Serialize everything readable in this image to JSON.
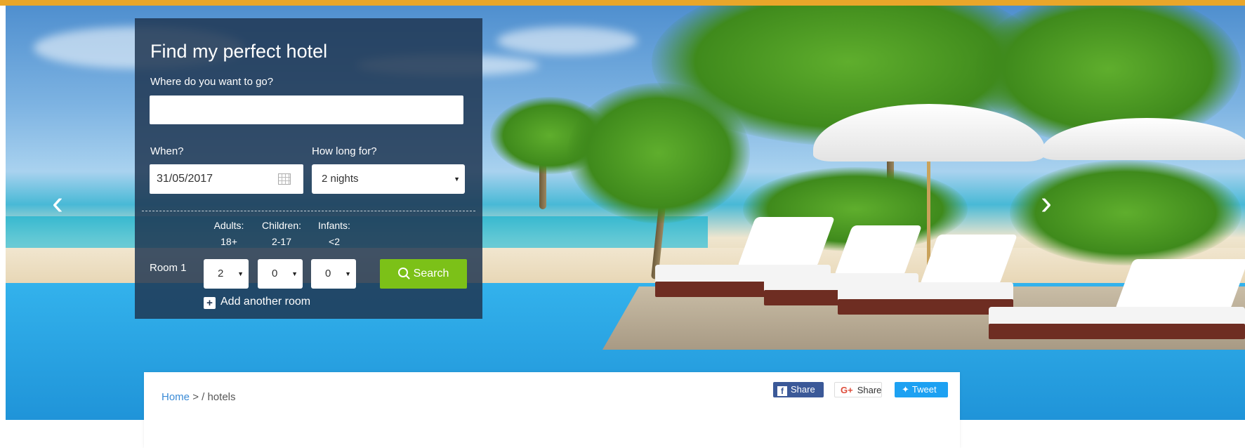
{
  "panel": {
    "title": "Find my perfect hotel",
    "destination_label": "Where do you want to go?",
    "destination_value": "",
    "when_label": "When?",
    "date_value": "31/05/2017",
    "duration_label": "How long for?",
    "duration_value": "2 nights",
    "adults_label": "Adults:",
    "adults_range": "18+",
    "children_label": "Children:",
    "children_range": "2-17",
    "infants_label": "Infants:",
    "infants_range": "<2",
    "room_label": "Room 1",
    "adults_value": "2",
    "children_value": "0",
    "infants_value": "0",
    "search_label": "Search",
    "add_room_label": "Add another room"
  },
  "carousel": {
    "prev_glyph": "‹",
    "next_glyph": "›"
  },
  "breadcrumb": {
    "home": "Home",
    "separator": "> /",
    "current": "hotels"
  },
  "share": {
    "facebook_label": "Share",
    "google_label": "Share",
    "twitter_label": "Tweet"
  },
  "colors": {
    "accent_bar": "#e9a62a",
    "search_button": "#7cc118",
    "panel_background": "rgba(30,52,80,0.84)"
  },
  "icons": [
    "calendar-icon",
    "search-icon",
    "plus-icon",
    "chevron-left-icon",
    "chevron-right-icon",
    "facebook-icon",
    "google-plus-icon",
    "twitter-icon"
  ]
}
